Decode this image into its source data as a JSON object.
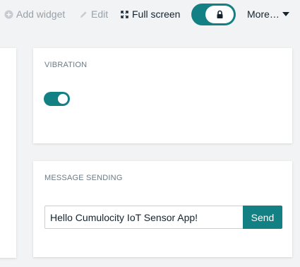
{
  "toolbar": {
    "add_widget_label": "Add widget",
    "edit_label": "Edit",
    "full_screen_label": "Full screen",
    "more_label": "More…",
    "lock_toggle_on": true
  },
  "vibration_widget": {
    "title": "VIBRATION",
    "switch_on": true
  },
  "message_widget": {
    "title": "MESSAGE SENDING",
    "input_value": "Hello Cumulocity IoT Sensor App!",
    "send_label": "Send"
  },
  "colors": {
    "accent": "#138183",
    "muted_text": "#98a1a8",
    "strong_text": "#14232e",
    "background": "#f2f3f4"
  }
}
